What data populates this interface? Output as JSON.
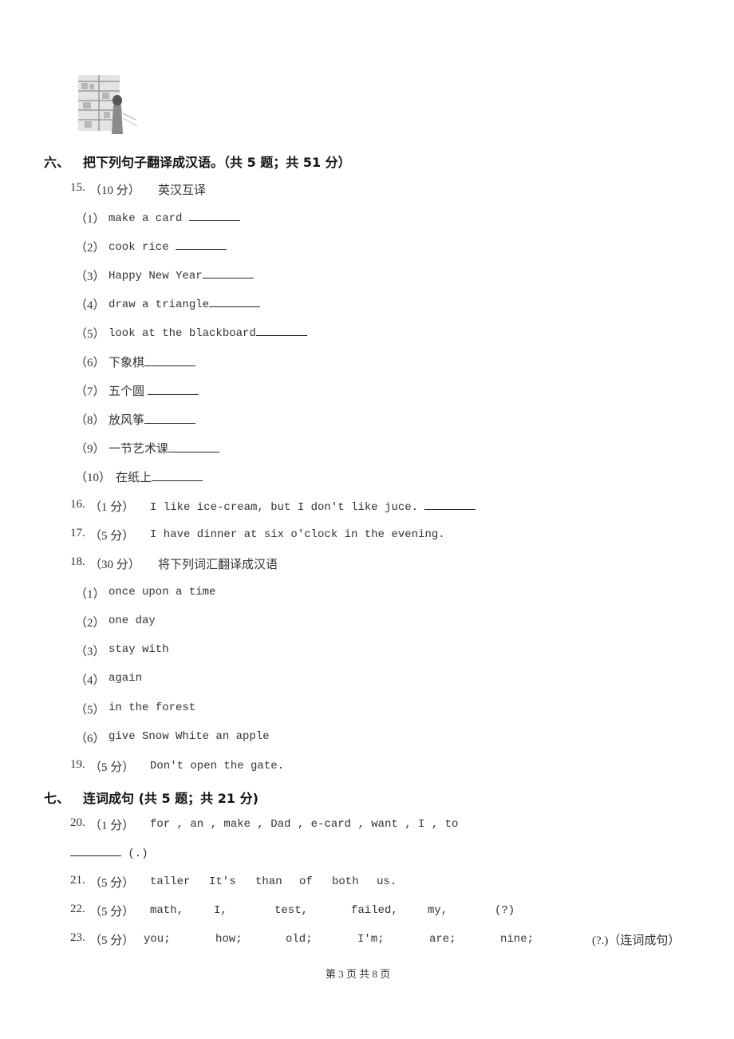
{
  "image": {
    "description": "grayscale illustration of a girl at a shelf"
  },
  "section6": {
    "label": "六、",
    "title": "把下列句子翻译成汉语。（共 5 题；共 51 分）",
    "q15": {
      "num": "15.",
      "score": "（10 分）",
      "prompt": "英汉互译",
      "items": [
        {
          "n": "（1）",
          "text": "make a card "
        },
        {
          "n": "（2）",
          "text": "cook rice "
        },
        {
          "n": "（3）",
          "text": "Happy New Year"
        },
        {
          "n": "（4）",
          "text": "draw a triangle"
        },
        {
          "n": "（5）",
          "text": "look at the blackboard"
        },
        {
          "n": "（6）",
          "text": "下象棋"
        },
        {
          "n": "（7）",
          "text": "五个圆 "
        },
        {
          "n": "（8）",
          "text": "放风筝"
        },
        {
          "n": "（9）",
          "text": "一节艺术课"
        },
        {
          "n": "（10）",
          "text": "在纸上"
        }
      ]
    },
    "q16": {
      "num": "16.",
      "score": "（1 分）",
      "text": "I like ice-cream, but I don't like juce. "
    },
    "q17": {
      "num": "17.",
      "score": "（5 分）",
      "text": "I have dinner at six o'clock in the evening."
    },
    "q18": {
      "num": "18.",
      "score": "（30 分）",
      "prompt": "将下列词汇翻译成汉语",
      "items": [
        {
          "n": "（1）",
          "text": "once upon a time"
        },
        {
          "n": "（2）",
          "text": "one day"
        },
        {
          "n": "（3）",
          "text": "stay with"
        },
        {
          "n": "（4）",
          "text": "again"
        },
        {
          "n": "（5）",
          "text": "in the forest"
        },
        {
          "n": "（6）",
          "text": "give Snow White an apple"
        }
      ]
    },
    "q19": {
      "num": "19.",
      "score": "（5 分）",
      "text": "Don't open the gate."
    }
  },
  "section7": {
    "label": "七、",
    "title": "连词成句 (共 5 题；共 21 分)",
    "q20": {
      "num": "20.",
      "score": "（1 分）",
      "text": "for , an , make , Dad , e-card , want , I , to",
      "tail": "(.)"
    },
    "q21": {
      "num": "21.",
      "score": "（5 分）",
      "words": [
        "taller",
        "It's",
        "than",
        "of",
        "both",
        "us."
      ]
    },
    "q22": {
      "num": "22.",
      "score": "（5 分）",
      "words": [
        "math,",
        "I,",
        "test,",
        "failed,",
        "my,",
        "(?)"
      ]
    },
    "q23": {
      "num": "23.",
      "score": "（5 分）",
      "words": [
        "you;",
        "how;",
        "old;",
        "I'm;",
        "are;",
        "nine;",
        "(?.)（连词成句）"
      ]
    }
  },
  "footer": {
    "page": "第 3 页 共 8 页"
  }
}
